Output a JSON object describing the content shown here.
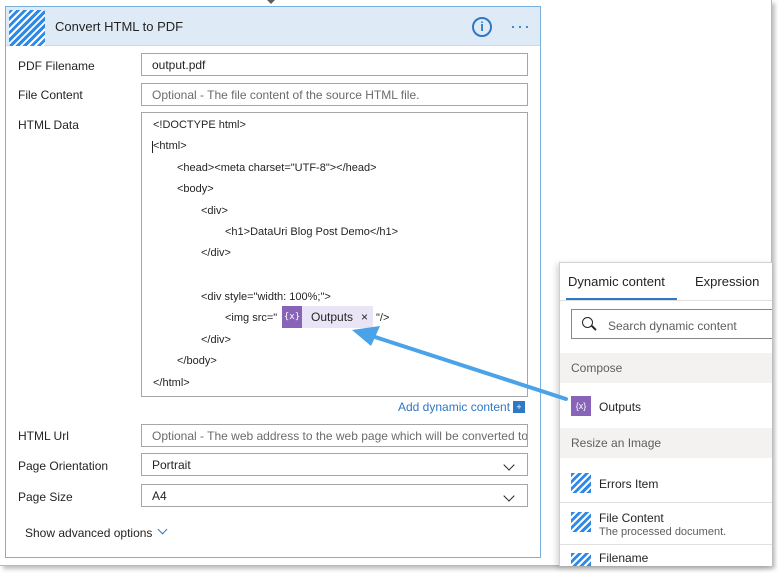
{
  "card": {
    "title": "Convert HTML to PDF",
    "info_icon": "i",
    "more_icon": "···",
    "icon": "striped-logo-icon",
    "accent_color": "#2e8ae6"
  },
  "fields": {
    "pdf_filename": {
      "label": "PDF Filename",
      "value": "output.pdf"
    },
    "file_content": {
      "label": "File Content",
      "placeholder": "Optional - The file content of the source HTML file."
    },
    "html_data": {
      "label": "HTML Data"
    },
    "html_url": {
      "label": "HTML Url",
      "placeholder": "Optional - The web address to the web page which will be converted to"
    },
    "page_orientation": {
      "label": "Page Orientation",
      "value": "Portrait"
    },
    "page_size": {
      "label": "Page Size",
      "value": "A4"
    }
  },
  "html_code": [
    "<!DOCTYPE html>",
    "<html>",
    "<head><meta charset=\"UTF-8\"></head>",
    "<body>",
    "<div>",
    "<h1>DataUri Blog Post Demo</h1>",
    "</div>",
    "<div style=\"width: 100%;\">",
    "<img src=\"",
    "\"/>",
    "</div>",
    "</body>",
    "</html>"
  ],
  "token": {
    "icon": "{x}",
    "label": "Outputs",
    "close": "×",
    "color": "#8764b8"
  },
  "add_dynamic_content": "Add dynamic content",
  "add_dynamic_icon": "+",
  "show_advanced": "Show advanced options",
  "panel": {
    "tabs": [
      "Dynamic content",
      "Expression"
    ],
    "search_placeholder": "Search dynamic content",
    "groups": [
      {
        "name": "Compose",
        "items": [
          {
            "title": "Outputs",
            "subtitle": "",
            "icon": "{x}"
          }
        ]
      },
      {
        "name": "Resize an Image",
        "items": [
          {
            "title": "Errors Item",
            "subtitle": ""
          },
          {
            "title": "File Content",
            "subtitle": "The processed document."
          },
          {
            "title": "Filename",
            "subtitle": ""
          }
        ]
      }
    ]
  },
  "arrow_color": "#4aa3e8"
}
